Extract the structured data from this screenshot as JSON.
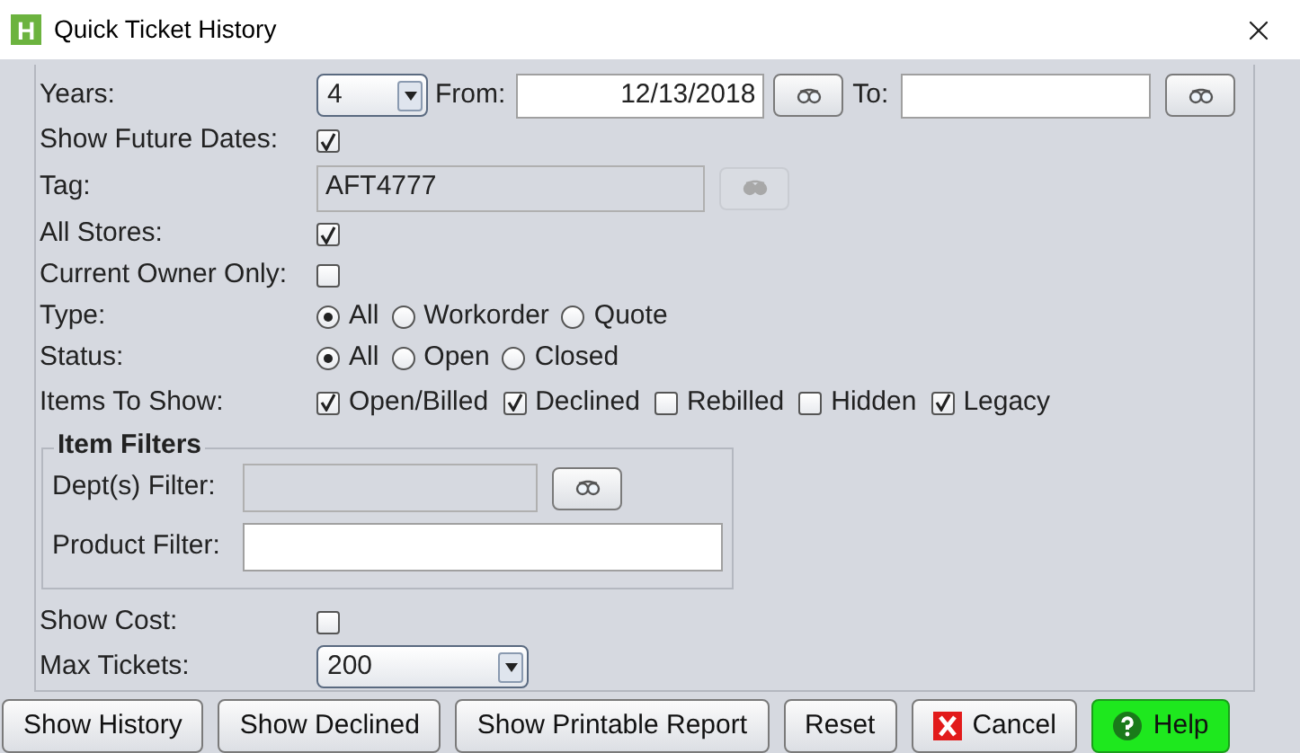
{
  "window": {
    "title": "Quick Ticket History",
    "app_icon": "H"
  },
  "years": {
    "label": "Years:",
    "value": "4"
  },
  "from": {
    "label": "From:",
    "value": "12/13/2018"
  },
  "to": {
    "label": "To:"
  },
  "show_future_dates": {
    "label": "Show Future Dates:",
    "checked": true
  },
  "tag": {
    "label": "Tag:",
    "value": "AFT4777",
    "disabled": true
  },
  "all_stores": {
    "label": "All Stores:",
    "checked": true
  },
  "current_owner_only": {
    "label": "Current Owner Only:",
    "checked": false
  },
  "type": {
    "label": "Type:",
    "options": [
      {
        "label": "All",
        "selected": true
      },
      {
        "label": "Workorder",
        "selected": false
      },
      {
        "label": "Quote",
        "selected": false
      }
    ]
  },
  "status": {
    "label": "Status:",
    "options": [
      {
        "label": "All",
        "selected": true
      },
      {
        "label": "Open",
        "selected": false
      },
      {
        "label": "Closed",
        "selected": false
      }
    ]
  },
  "items_to_show": {
    "label": "Items To Show:",
    "options": [
      {
        "label": "Open/Billed",
        "checked": true
      },
      {
        "label": "Declined",
        "checked": true
      },
      {
        "label": "Rebilled",
        "checked": false
      },
      {
        "label": "Hidden",
        "checked": false
      },
      {
        "label": "Legacy",
        "checked": true
      }
    ]
  },
  "item_filters": {
    "title": "Item Filters",
    "dept_filter": {
      "label": "Dept(s) Filter:",
      "disabled": true
    },
    "product_filter": {
      "label": "Product Filter:",
      "disabled": false
    }
  },
  "show_cost": {
    "label": "Show Cost:",
    "checked": false
  },
  "max_tickets": {
    "label": "Max Tickets:",
    "value": "200"
  },
  "buttons": [
    {
      "label": "Show History",
      "kind": "plain"
    },
    {
      "label": "Show Declined",
      "kind": "plain"
    },
    {
      "label": "Show Printable Report",
      "kind": "plain"
    },
    {
      "label": "Reset",
      "kind": "plain"
    },
    {
      "label": "Cancel",
      "kind": "cancel"
    },
    {
      "label": "Help",
      "kind": "help"
    }
  ]
}
